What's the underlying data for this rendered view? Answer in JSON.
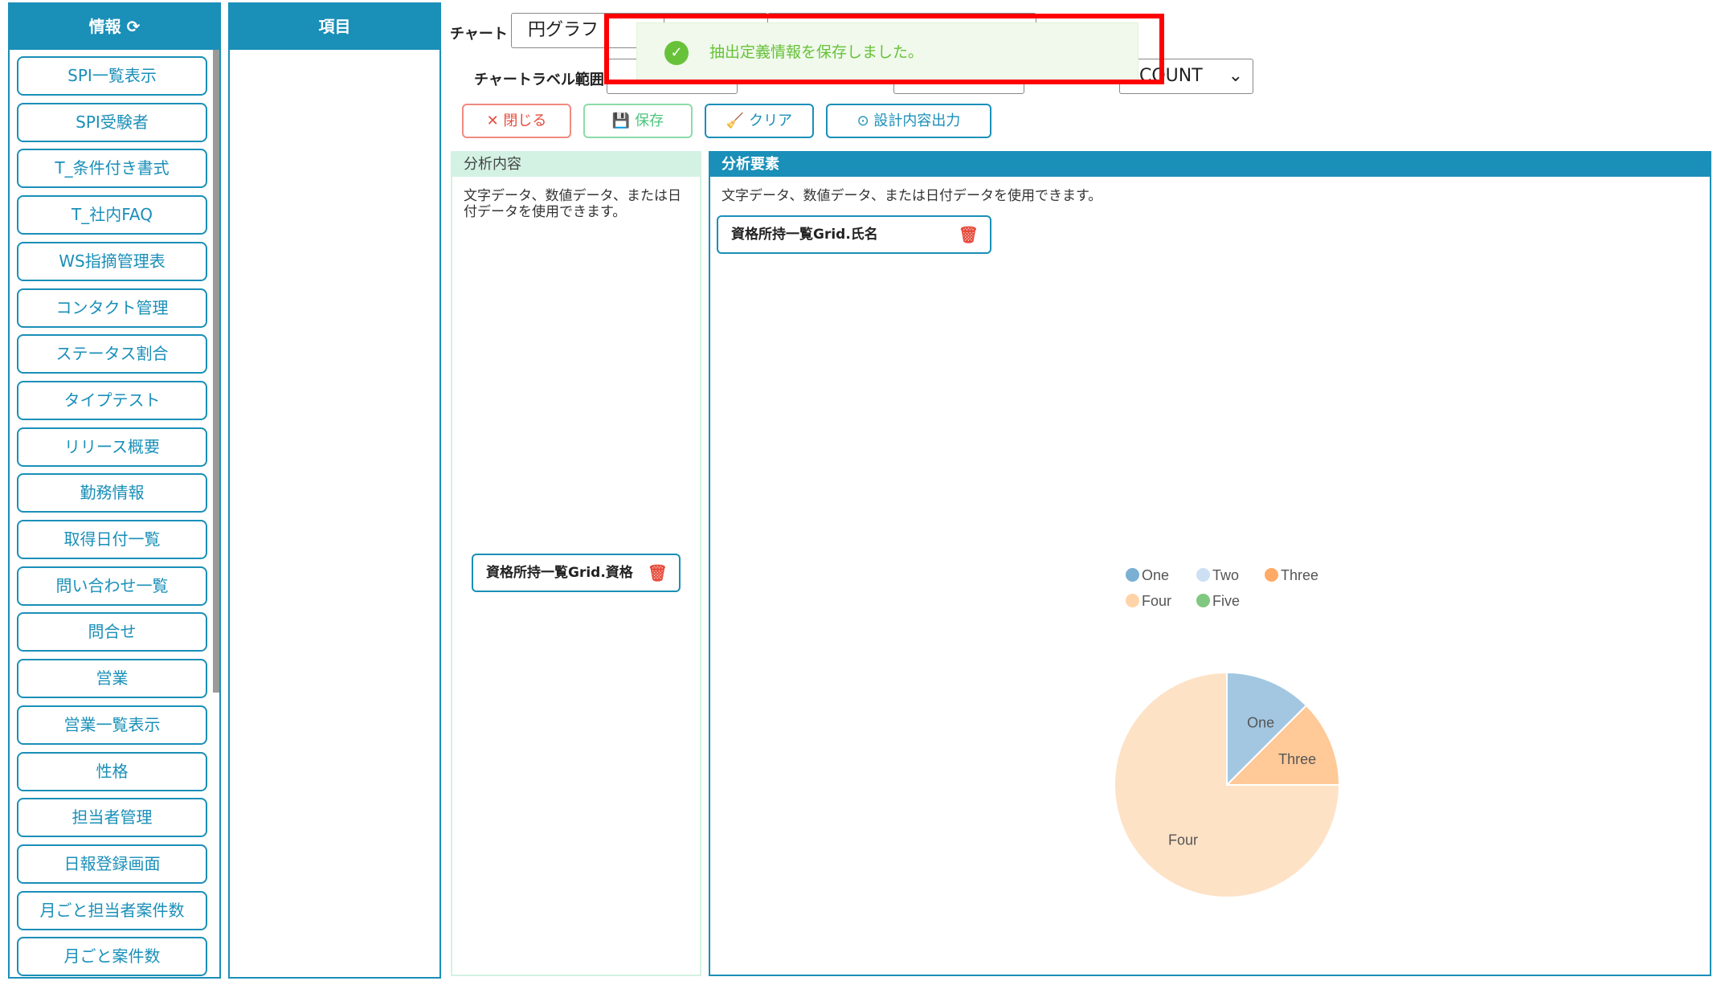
{
  "sidebar": {
    "title": "情報",
    "refresh_icon": "refresh-icon",
    "items": [
      "SPI一覧表示",
      "SPI受験者",
      "T_条件付き書式",
      "T_社内FAQ",
      "WS指摘管理表",
      "コンタクト管理",
      "ステータス割合",
      "タイプテスト",
      "リリース概要",
      "勤務情報",
      "取得日付一覧",
      "問い合わせ一覧",
      "問合せ",
      "営業",
      "営業一覧表示",
      "性格",
      "担当者管理",
      "日報登録画面",
      "月ごと担当者案件数",
      "月ごと案件数"
    ]
  },
  "items_panel": {
    "title": "項目"
  },
  "form": {
    "chart_label": "チャート",
    "chart_value": "円グラフ",
    "label_range_label": "チャートラベル範囲",
    "agg_value": "COUNT"
  },
  "toolbar": {
    "close": "閉じる",
    "save": "保存",
    "clear": "クリア",
    "export": "設計内容出力"
  },
  "toast": {
    "message": "抽出定義情報を保存しました。"
  },
  "analysis_content": {
    "title": "分析内容",
    "description": "文字データ、数値データ、または日付データを使用できます。",
    "chip": "資格所持一覧Grid.資格"
  },
  "analysis_elements": {
    "title": "分析要素",
    "description": "文字データ、数値データ、または日付データを使用できます。",
    "chip": "資格所持一覧Grid.氏名"
  },
  "chart_data": {
    "type": "pie",
    "legend_position": "top",
    "categories": [
      "One",
      "Two",
      "Three",
      "Four",
      "Five"
    ],
    "values": [
      1,
      0,
      1,
      6,
      0
    ],
    "legend_colors": [
      "#7bafd4",
      "#cddff2",
      "#ffaa66",
      "#ffd3a8",
      "#80c77f"
    ],
    "slice_colors": [
      "#a3c7e1",
      "#cddff2",
      "#ffc998",
      "#fde2c6",
      "#80c77f"
    ]
  }
}
